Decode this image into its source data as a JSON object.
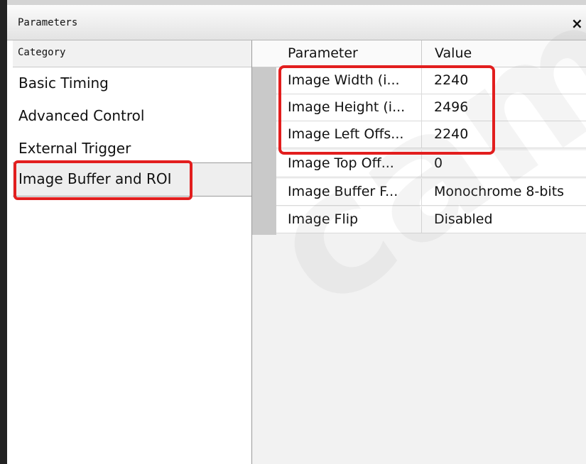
{
  "window": {
    "title": "Parameters",
    "close_glyph": "×"
  },
  "category_panel": {
    "header": "Category",
    "items": [
      {
        "label": "Basic Timing"
      },
      {
        "label": "Advanced Control"
      },
      {
        "label": "External Trigger"
      },
      {
        "label": "Image Buffer and ROI",
        "selected": true
      }
    ]
  },
  "parameter_grid": {
    "columns": [
      "Parameter",
      "Value"
    ],
    "rows": [
      {
        "parameter": "Image Width (i...",
        "value": "2240"
      },
      {
        "parameter": "Image Height (i...",
        "value": "2496"
      },
      {
        "parameter": "Image Left Offs...",
        "value": "2240"
      },
      {
        "parameter": "Image Top Off...",
        "value": "0"
      },
      {
        "parameter": "Image Buffer F...",
        "value": "Monochrome 8-bits"
      },
      {
        "parameter": "Image Flip",
        "value": "Disabled"
      }
    ]
  },
  "watermark": {
    "text": "camera"
  },
  "colors": {
    "highlight": "#e21e1e",
    "selected_bg": "#eeeeee",
    "grid_bg": "#f2f2f2"
  }
}
